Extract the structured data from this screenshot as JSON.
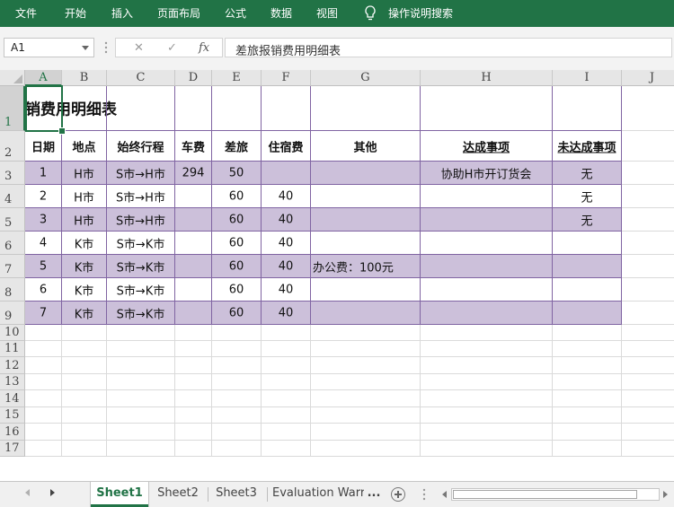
{
  "ribbon": {
    "tabs": [
      "文件",
      "开始",
      "插入",
      "页面布局",
      "公式",
      "数据",
      "视图"
    ],
    "tell_me": "操作说明搜索"
  },
  "formula_bar": {
    "name_box": "A1",
    "cancel_icon": "✕",
    "enter_icon": "✓",
    "fx_label": "fx",
    "content": "差旅报销费用明细表"
  },
  "grid": {
    "columns": [
      "A",
      "B",
      "C",
      "D",
      "E",
      "F",
      "G",
      "H",
      "I",
      "J"
    ],
    "rows": [
      "1",
      "2",
      "3",
      "4",
      "5",
      "6",
      "7",
      "8",
      "9",
      "10",
      "11",
      "12",
      "13",
      "14",
      "15",
      "16",
      "17"
    ],
    "title_visible": "销费用明细表",
    "headers": [
      "日期",
      "地点",
      "始终行程",
      "车费",
      "差旅",
      "住宿费",
      "其他",
      "达成事项",
      "未达成事项"
    ],
    "data_rows": [
      [
        "1",
        "H市",
        "S市→H市",
        "294",
        "50",
        "",
        "",
        "协助H市开订货会",
        "无"
      ],
      [
        "2",
        "H市",
        "S市→H市",
        "",
        "60",
        "40",
        "",
        "",
        "无"
      ],
      [
        "3",
        "H市",
        "S市→H市",
        "",
        "60",
        "40",
        "",
        "",
        "无"
      ],
      [
        "4",
        "K市",
        "S市→K市",
        "",
        "60",
        "40",
        "",
        "",
        ""
      ],
      [
        "5",
        "K市",
        "S市→K市",
        "",
        "60",
        "40",
        "办公费：100元",
        "",
        ""
      ],
      [
        "6",
        "K市",
        "S市→K市",
        "",
        "60",
        "40",
        "",
        "",
        ""
      ],
      [
        "7",
        "K市",
        "S市→K市",
        "",
        "60",
        "40",
        "",
        "",
        ""
      ]
    ],
    "band_color": "#ccc0da",
    "border_color": "#8064a2"
  },
  "sheets": {
    "tabs": [
      "Sheet1",
      "Sheet2",
      "Sheet3",
      "Evaluation Warr"
    ],
    "more": "...",
    "accent": "#217346"
  }
}
